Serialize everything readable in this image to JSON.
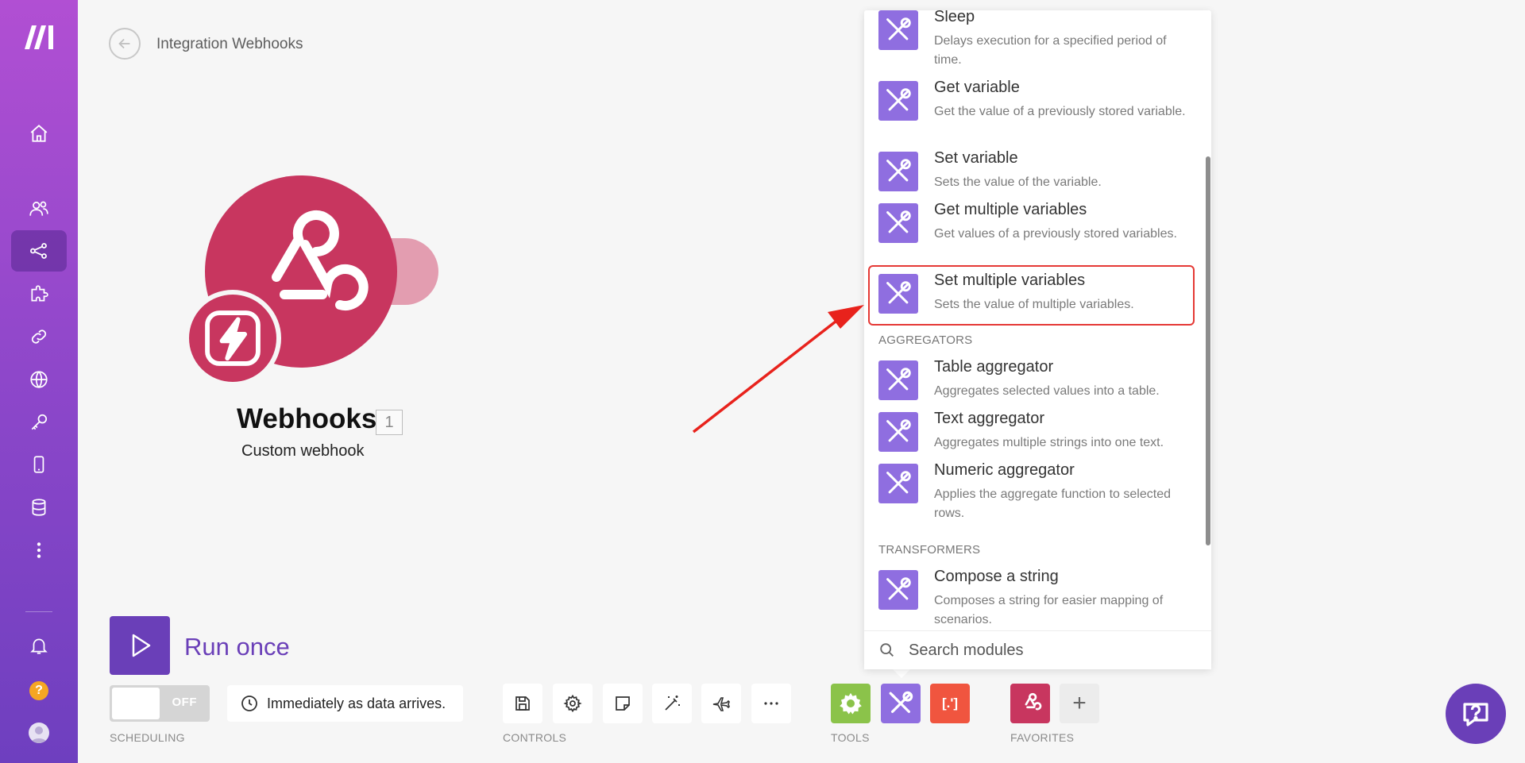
{
  "header": {
    "title": "Integration Webhooks"
  },
  "module": {
    "name": "Webhooks",
    "count": "1",
    "subtitle": "Custom webhook",
    "color": "#c8365f"
  },
  "run": {
    "label": "Run once"
  },
  "toolbar": {
    "toggle_label": "OFF",
    "schedule_text": "Immediately as data arrives.",
    "sections": {
      "scheduling": "SCHEDULING",
      "controls": "CONTROLS",
      "tools": "TOOLS",
      "favorites": "FAVORITES"
    },
    "tools_bracket_label": "[.']",
    "add_label": "+"
  },
  "panel": {
    "items_top": [
      {
        "name": "Sleep",
        "desc": "Delays execution for a specified period of time."
      },
      {
        "name": "Get variable",
        "desc": "Get the value of a previously stored variable."
      },
      {
        "name": "Set variable",
        "desc": "Sets the value of the variable."
      },
      {
        "name": "Get multiple variables",
        "desc": "Get values of a previously stored variables."
      },
      {
        "name": "Set multiple variables",
        "desc": "Sets the value of multiple variables."
      }
    ],
    "aggregators_label": "AGGREGATORS",
    "aggregators": [
      {
        "name": "Table aggregator",
        "desc": "Aggregates selected values into a table."
      },
      {
        "name": "Text aggregator",
        "desc": "Aggregates multiple strings into one text."
      },
      {
        "name": "Numeric aggregator",
        "desc": "Applies the aggregate function to selected rows."
      }
    ],
    "transformers_label": "TRANSFORMERS",
    "transformers": [
      {
        "name": "Compose a string",
        "desc": "Composes a string for easier mapping of scenarios."
      }
    ],
    "search_placeholder": "Search modules"
  },
  "colors": {
    "brand": "#6a3fb8",
    "tools_purple": "#8f6ee0",
    "highlight": "#e53935"
  }
}
